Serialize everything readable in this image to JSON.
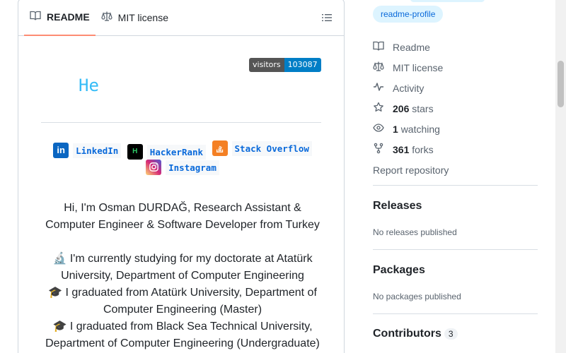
{
  "readme": {
    "tabs": [
      {
        "label": "README",
        "active": true,
        "icon": "book-icon"
      },
      {
        "label": "MIT license",
        "active": false,
        "icon": "law-icon"
      }
    ],
    "visitors_badge": {
      "label": "visitors",
      "count": "103087"
    },
    "typing_text": "He",
    "socials": [
      {
        "name": "LinkedIn",
        "color": "#0A66C2"
      },
      {
        "name": "HackerRank",
        "color": "#000000"
      },
      {
        "name": "Stack Overflow",
        "color": "#F48024"
      },
      {
        "name": "Instagram",
        "color": "#C13584"
      }
    ],
    "intro_line1": "Hi, I'm Osman DURDAĞ, Research Assistant &",
    "intro_line2": "Computer Engineer & Software Developer from Turkey",
    "study_line1": "I'm currently studying for my doctorate at Atatürk",
    "study_line2": "University, Department of Computer Engineering",
    "grad1_line1": "I graduated from Atatürk University, Department of",
    "grad1_line2": "Computer Engineering (Master)",
    "grad2_line1": "I graduated from Black Sea Technical University,",
    "grad2_line2": "Department of Computer Engineering (Undergraduate)"
  },
  "sidebar": {
    "topic": "readme-profile",
    "links": [
      {
        "label": "Readme",
        "icon": "book-icon"
      },
      {
        "label": "MIT license",
        "icon": "law-icon"
      },
      {
        "label": "Activity",
        "icon": "pulse-icon"
      },
      {
        "count": "206",
        "label": "stars",
        "icon": "star-icon"
      },
      {
        "count": "1",
        "label": "watching",
        "icon": "eye-icon"
      },
      {
        "count": "361",
        "label": "forks",
        "icon": "fork-icon"
      }
    ],
    "report": "Report repository",
    "releases_title": "Releases",
    "releases_sub": "No releases published",
    "packages_title": "Packages",
    "packages_sub": "No packages published",
    "contributors_title": "Contributors",
    "contributors_count": "3"
  }
}
